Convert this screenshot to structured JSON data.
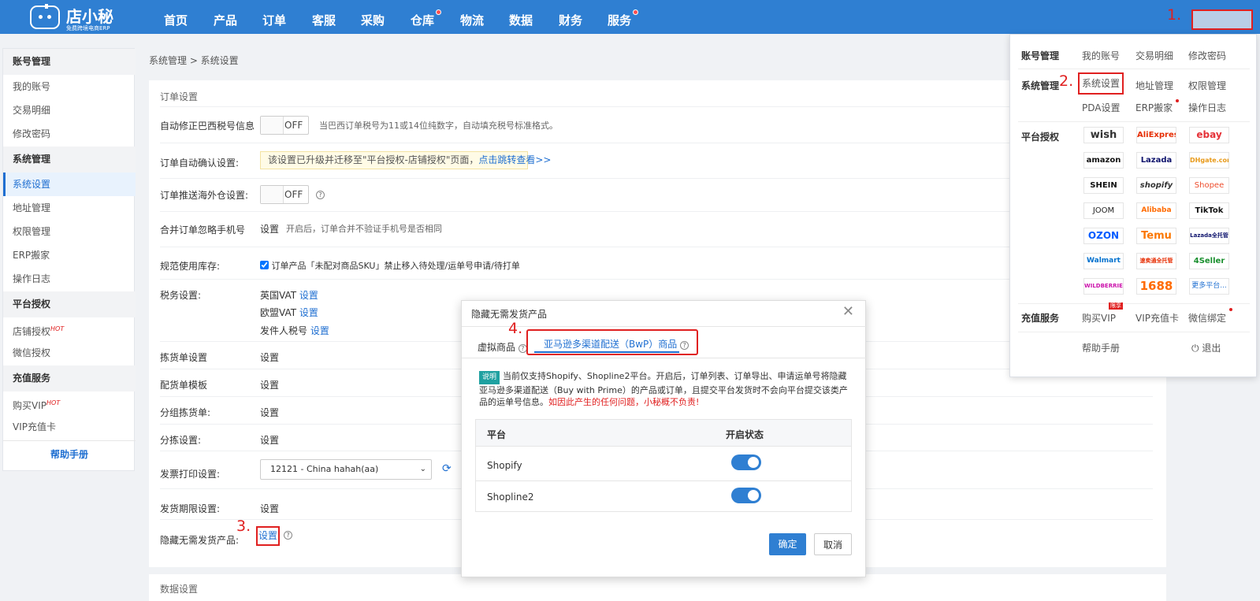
{
  "logo": {
    "name": "店小秘",
    "sub": "免费跨境电商ERP"
  },
  "nav": [
    "首页",
    "产品",
    "订单",
    "客服",
    "采购",
    "仓库",
    "物流",
    "数据",
    "财务",
    "服务"
  ],
  "annotations": {
    "n1": "1.",
    "n2": "2.",
    "n3": "3.",
    "n4": "4."
  },
  "sidebar": {
    "account_title": "账号管理",
    "account_items": [
      "我的账号",
      "交易明细",
      "修改密码"
    ],
    "system_title": "系统管理",
    "system_items": [
      "系统设置",
      "地址管理",
      "权限管理",
      "ERP搬家",
      "操作日志"
    ],
    "platform_title": "平台授权",
    "platform_items": [
      "店铺授权",
      "微信授权"
    ],
    "recharge_title": "充值服务",
    "recharge_items": [
      "购买VIP",
      "VIP充值卡"
    ],
    "help": "帮助手册",
    "hot": "HOT"
  },
  "breadcrumb": "系统管理 > 系统设置",
  "order_settings": {
    "section_title": "订单设置",
    "brazil_label": "自动修正巴西税号信息",
    "off": "OFF",
    "brazil_hint": "当巴西订单税号为11或14位纯数字，自动填充税号标准格式。",
    "auto_confirm_label": "订单自动确认设置:",
    "auto_confirm_notice": "该设置已升级并迁移至\"平台授权-店铺授权\"页面，",
    "auto_confirm_link": "点击跳转查看>>",
    "push_label": "订单推送海外仓设置:",
    "merge_label": "合并订单忽略手机号",
    "set": "设置",
    "merge_hint": "开启后，订单合并不验证手机号是否相同",
    "stock_label": "规范使用库存:",
    "stock_check": "订单产品「未配对商品SKU」禁止移入待处理/运单号申请/待打单",
    "tax_label": "税务设置:",
    "tax_items": [
      "英国VAT",
      "欧盟VAT",
      "发件人税号"
    ],
    "pick_label": "拣货单设置",
    "match_label": "配货单模板",
    "group_label": "分组拣货单:",
    "sort_label": "分拣设置:",
    "invoice_label": "发票打印设置:",
    "invoice_value": "12121 - China hahah(aa)",
    "ship_label": "发货期限设置:",
    "hide_label": "隐藏无需发货产品:"
  },
  "data_section_title": "数据设置",
  "dropdown": {
    "account_title": "账号管理",
    "account_items": [
      "我的账号",
      "交易明细",
      "修改密码"
    ],
    "system_title": "系统管理",
    "system_items": [
      "系统设置",
      "地址管理",
      "权限管理",
      "PDA设置",
      "ERP搬家",
      "操作日志"
    ],
    "platform_title": "平台授权",
    "platforms": [
      "wish",
      "AliExpress",
      "ebay",
      "amazon",
      "Lazada",
      "DHgate.com",
      "SHEIN",
      "shopify",
      "Shopee",
      "JOOM",
      "Alibaba",
      "TikTok",
      "OZON",
      "Temu",
      "Lazada全托管",
      "Walmart",
      "速卖通全托管",
      "4Seller",
      "WILDBERRIES",
      "1688",
      "更多平台..."
    ],
    "recharge_title": "充值服务",
    "recharge_items": [
      "购买VIP",
      "VIP充值卡",
      "微信绑定"
    ],
    "vip_badge": "限享",
    "help": "帮助手册",
    "logout": "退出"
  },
  "modal": {
    "title": "隐藏无需发货产品",
    "tabs": [
      "虚拟商品",
      "亚马逊多渠道配送（BwP）商品"
    ],
    "tag": "说明",
    "desc": "当前仅支持Shopify、Shopline2平台。开启后，订单列表、订单导出、申请运单号将隐藏亚马逊多渠道配送（Buy with Prime）的产品或订单，且提交平台发货时不会向平台提交该类产品的运单号信息。",
    "warn": "如因此产生的任何问题，小秘概不负责!",
    "col_platform": "平台",
    "col_status": "开启状态",
    "rows": [
      {
        "platform": "Shopify",
        "enabled": true
      },
      {
        "platform": "Shopline2",
        "enabled": true
      }
    ],
    "confirm": "确定",
    "cancel": "取消"
  }
}
